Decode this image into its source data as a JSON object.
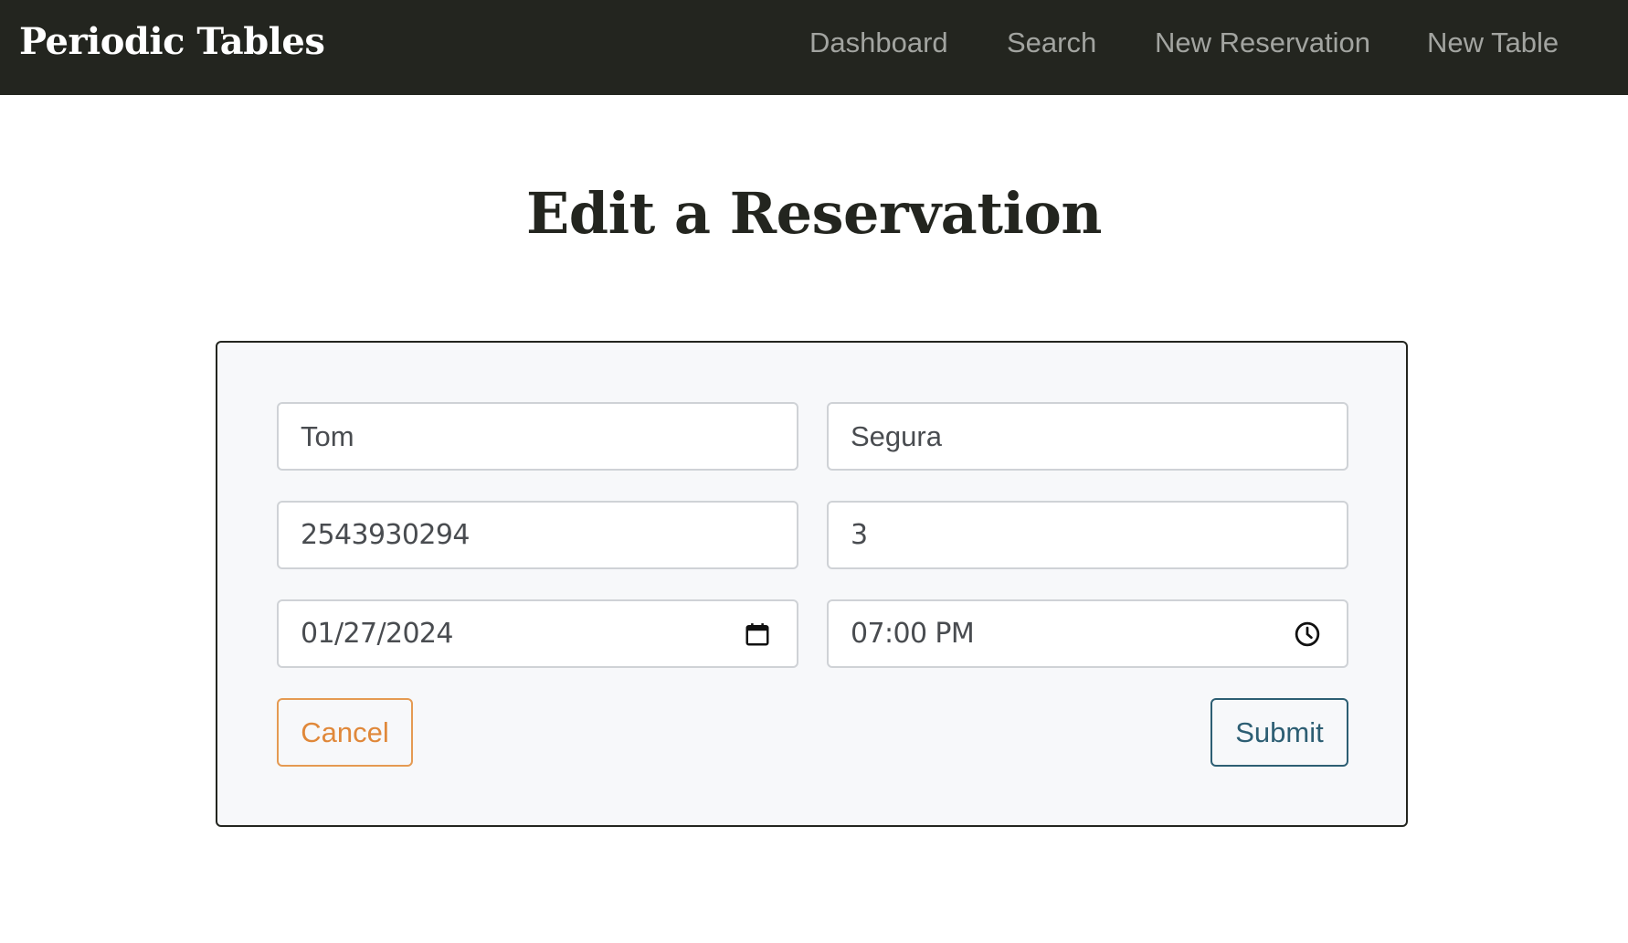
{
  "nav": {
    "brand": "Periodic Tables",
    "links": [
      {
        "label": "Dashboard"
      },
      {
        "label": "Search"
      },
      {
        "label": "New Reservation"
      },
      {
        "label": "New Table"
      }
    ]
  },
  "page": {
    "title": "Edit a Reservation"
  },
  "form": {
    "first_name": "Tom",
    "last_name": "Segura",
    "mobile_number": "2543930294",
    "people": "3",
    "reservation_date": "01/27/2024",
    "reservation_time": "07:00 PM",
    "date_icon": "calendar-icon",
    "time_icon": "clock-icon",
    "cancel_label": "Cancel",
    "submit_label": "Submit"
  },
  "colors": {
    "navbar_bg": "#23251f",
    "cancel_accent": "#e0883a",
    "submit_accent": "#2d5e73",
    "card_bg": "#f7f8fa"
  }
}
